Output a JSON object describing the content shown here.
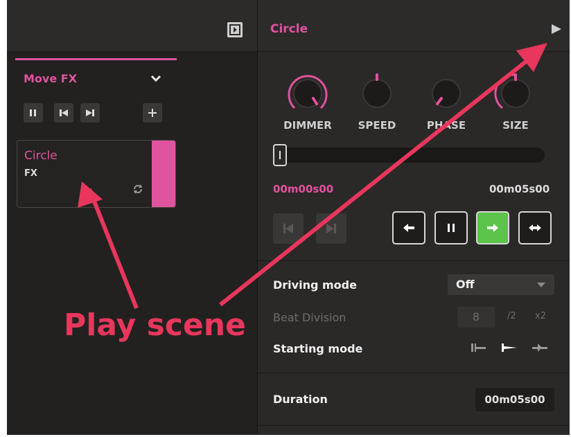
{
  "left_panel": {
    "list_header": "Move FX",
    "scene_card": {
      "name": "Circle",
      "subtitle": "FX"
    }
  },
  "right_panel": {
    "scene_title": "Circle",
    "knobs": [
      {
        "label": "DIMMER"
      },
      {
        "label": "SPEED"
      },
      {
        "label": "PHASE"
      },
      {
        "label": "SIZE"
      }
    ],
    "time_start": "00m00s00",
    "time_end": "00m05s00",
    "driving_mode_label": "Driving mode",
    "driving_mode_value": "Off",
    "beat_division_label": "Beat Division",
    "beat_division_value": "8",
    "beat_half": "/2",
    "beat_double": "x2",
    "starting_mode_label": "Starting mode",
    "duration_label": "Duration",
    "duration_value": "00m05s00"
  },
  "annotation": {
    "text": "Play scene"
  },
  "colors": {
    "accent": "#e0539e",
    "active_direction": "#5cc34b",
    "annotation": "#e8365c"
  }
}
